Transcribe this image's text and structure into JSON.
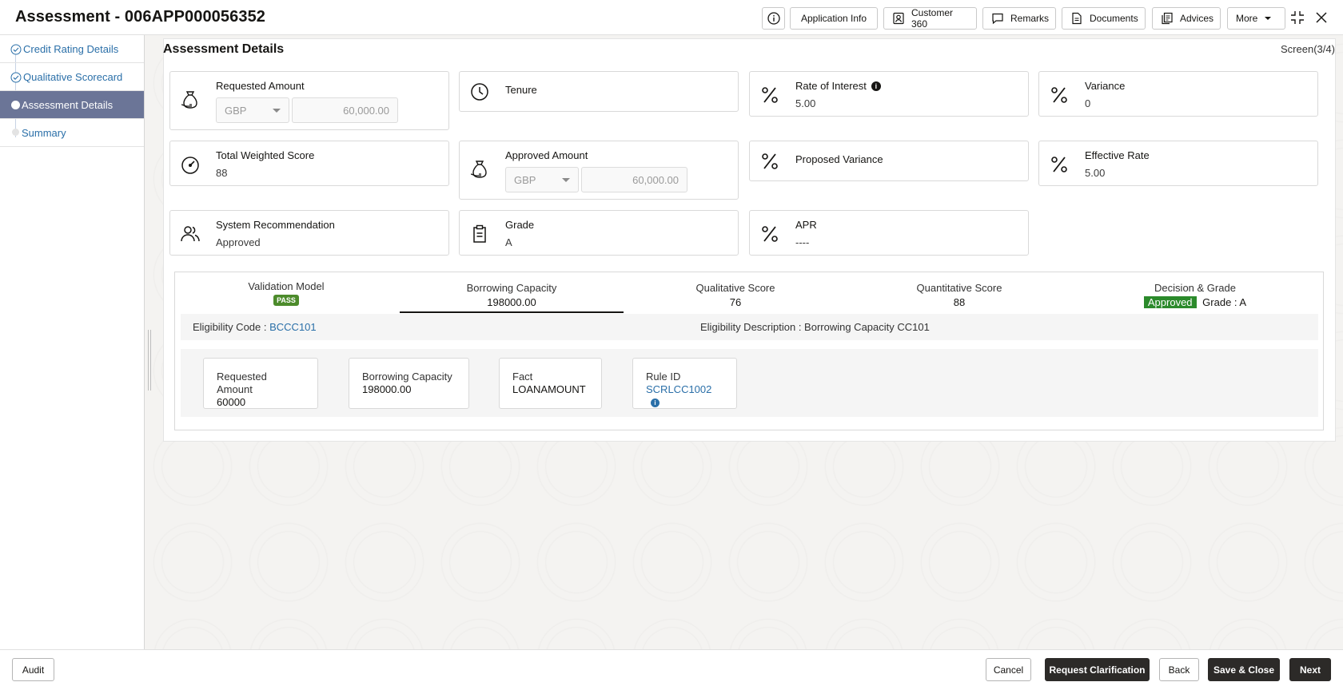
{
  "header": {
    "title": "Assessment - 006APP000056352",
    "buttons": {
      "application_info": "Application Info",
      "customer_360": "Customer 360",
      "remarks": "Remarks",
      "documents": "Documents",
      "advices": "Advices",
      "more": "More"
    }
  },
  "sidebar": {
    "items": [
      {
        "label": "Credit Rating Details",
        "state": "completed"
      },
      {
        "label": "Qualitative Scorecard",
        "state": "completed"
      },
      {
        "label": "Assessment Details",
        "state": "active"
      },
      {
        "label": "Summary",
        "state": "pending"
      }
    ],
    "audit_label": "Audit"
  },
  "main": {
    "title": "Assessment Details",
    "screen_indicator": "Screen(3/4)",
    "cards": {
      "requested_amount": {
        "title": "Requested Amount",
        "currency": "GBP",
        "amount": "60,000.00",
        "icon": "money-bag-icon"
      },
      "tenure": {
        "title": "Tenure",
        "icon": "clock-icon"
      },
      "rate_of_interest": {
        "title": "Rate of Interest",
        "value": "5.00",
        "icon": "percent-icon"
      },
      "variance": {
        "title": "Variance",
        "value": "0",
        "icon": "percent-icon"
      },
      "total_weighted_score": {
        "title": "Total Weighted Score",
        "value": "88",
        "icon": "gauge-icon"
      },
      "approved_amount": {
        "title": "Approved Amount",
        "currency": "GBP",
        "amount": "60,000.00",
        "icon": "money-bag-icon"
      },
      "proposed_variance": {
        "title": "Proposed Variance",
        "icon": "percent-icon"
      },
      "effective_rate": {
        "title": "Effective Rate",
        "value": "5.00",
        "icon": "percent-icon"
      },
      "system_recommendation": {
        "title": "System Recommendation",
        "value": "Approved",
        "icon": "users-icon"
      },
      "grade": {
        "title": "Grade",
        "value": "A",
        "icon": "clipboard-icon"
      },
      "apr": {
        "title": "APR",
        "value": "----",
        "icon": "percent-icon"
      }
    },
    "results": {
      "tabs": {
        "validation_model": {
          "label": "Validation Model",
          "badge": "PASS"
        },
        "borrowing_capacity": {
          "label": "Borrowing Capacity",
          "value": "198000.00"
        },
        "qualitative_score": {
          "label": "Qualitative Score",
          "value": "76"
        },
        "quantitative_score": {
          "label": "Quantitative Score",
          "value": "88"
        },
        "decision_grade": {
          "label": "Decision & Grade",
          "decision": "Approved",
          "grade": "Grade : A"
        }
      },
      "eligibility": {
        "code_label": "Eligibility Code : ",
        "code": "BCCC101",
        "description": "Eligibility Description : Borrowing Capacity CC101"
      },
      "facts": {
        "requested_amount": {
          "label": "Requested Amount",
          "value": "60000"
        },
        "borrowing_capacity": {
          "label": "Borrowing Capacity",
          "value": "198000.00"
        },
        "fact": {
          "label": "Fact",
          "value": "LOANAMOUNT"
        },
        "rule_id": {
          "label": "Rule ID",
          "value": "SCRLCC1002"
        }
      }
    }
  },
  "footer": {
    "cancel": "Cancel",
    "request_clarification": "Request Clarification",
    "back": "Back",
    "save_close": "Save & Close",
    "next": "Next"
  }
}
